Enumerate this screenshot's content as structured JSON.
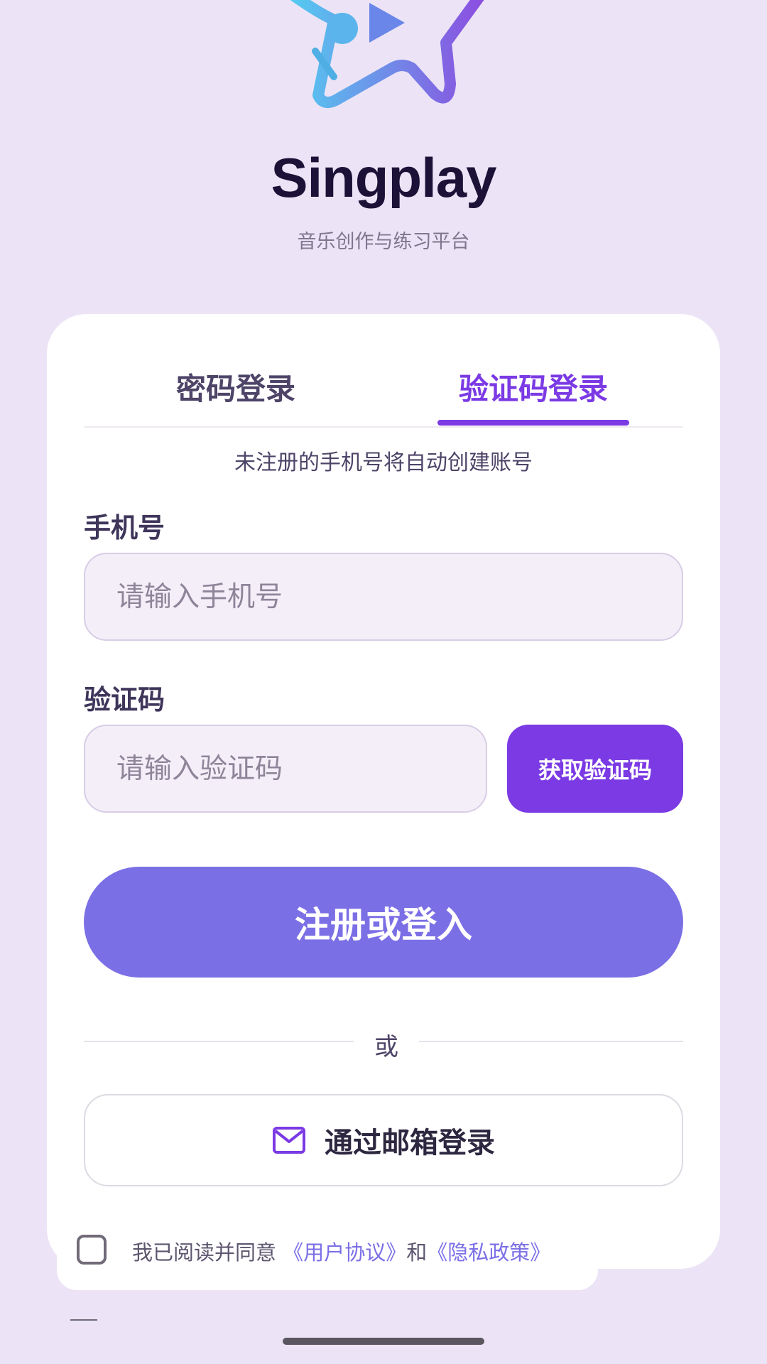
{
  "app": {
    "title": "Singplay",
    "subtitle": "音乐创作与练习平台"
  },
  "tabs": [
    {
      "label": "密码登录",
      "active": false
    },
    {
      "label": "验证码登录",
      "active": true
    }
  ],
  "hint": "未注册的手机号将自动创建账号",
  "form": {
    "phone_label": "手机号",
    "phone_placeholder": "请输入手机号",
    "phone_value": "",
    "code_label": "验证码",
    "code_placeholder": "请输入验证码",
    "code_value": "",
    "get_code_label": "获取验证码",
    "submit_label": "注册或登入"
  },
  "divider_text": "或",
  "email_login": {
    "label": "通过邮箱登录",
    "icon": "mail-icon"
  },
  "agreement": {
    "prefix": "我已阅读并同意",
    "user_agreement": "《用户协议》",
    "conjunction": "和",
    "privacy_policy": "《隐私政策》",
    "checked": false
  },
  "colors": {
    "background": "#ECE4F6",
    "accent": "#7B3AE4",
    "submit": "#7B6FE6",
    "link": "#7B6FE6"
  }
}
